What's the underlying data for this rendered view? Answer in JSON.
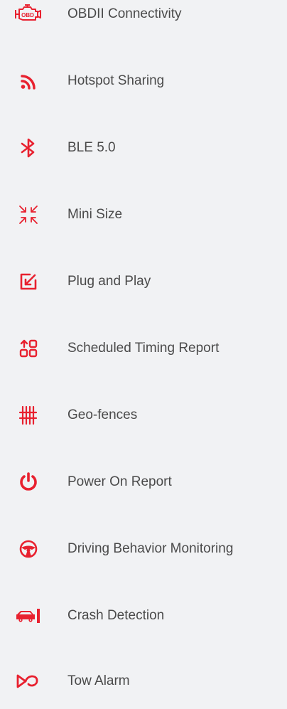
{
  "accent_color": "#e8212f",
  "features": [
    {
      "label": "OBDII Connectivity",
      "icon": "obd-engine-icon"
    },
    {
      "label": "Hotspot Sharing",
      "icon": "wifi-signal-icon"
    },
    {
      "label": "BLE 5.0",
      "icon": "bluetooth-icon"
    },
    {
      "label": "Mini Size",
      "icon": "compress-arrows-icon"
    },
    {
      "label": "Plug and Play",
      "icon": "plug-in-arrow-icon"
    },
    {
      "label": "Scheduled Timing Report",
      "icon": "grid-report-icon"
    },
    {
      "label": "Geo-fences",
      "icon": "fence-icon"
    },
    {
      "label": "Power On Report",
      "icon": "power-icon"
    },
    {
      "label": "Driving Behavior Monitoring",
      "icon": "steering-wheel-icon"
    },
    {
      "label": "Crash Detection",
      "icon": "car-crash-icon"
    },
    {
      "label": "Tow Alarm",
      "icon": "tow-alarm-icon"
    }
  ]
}
